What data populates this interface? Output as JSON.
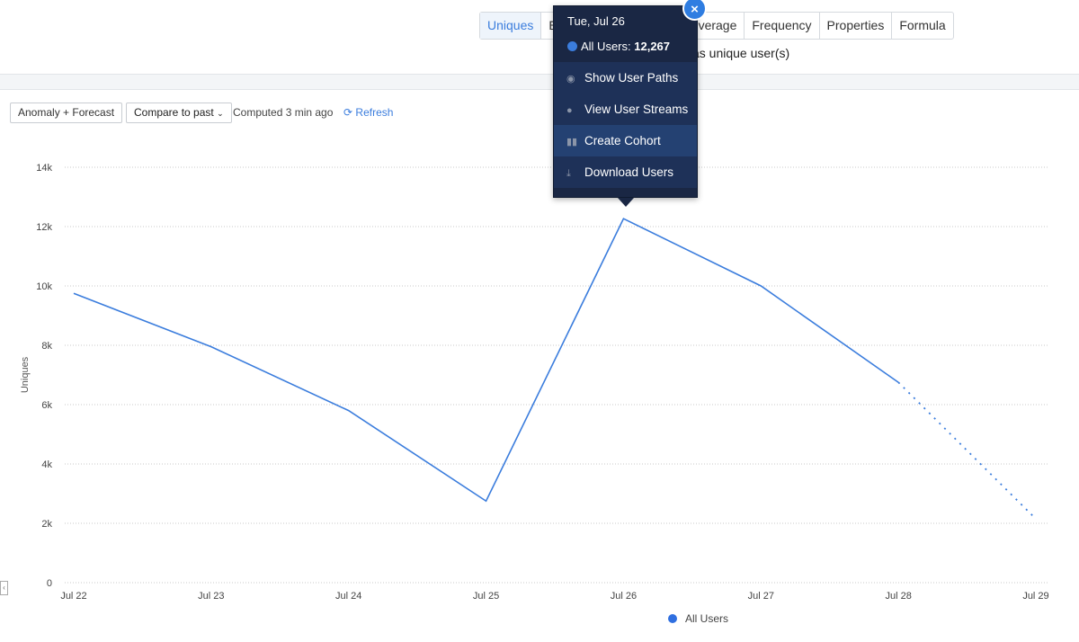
{
  "tabs": [
    {
      "label": "Uniques",
      "active": true
    },
    {
      "label": "E"
    },
    {
      "label": ""
    },
    {
      "label": "verage"
    },
    {
      "label": "Frequency"
    },
    {
      "label": "Properties"
    },
    {
      "label": "Formula"
    }
  ],
  "subtitle": "as unique user(s)",
  "toolbar": {
    "anomaly_label": "Anomaly + Forecast",
    "compare_label": "Compare to past",
    "compare_chevron": "⌄",
    "computed": "Computed 3 min ago",
    "refresh_label": "Refresh",
    "refresh_icon": "refresh-icon"
  },
  "tooltip": {
    "date": "Tue, Jul 26",
    "series": "All Users:",
    "value": "12,267",
    "close": "×",
    "actions": [
      {
        "label": "Show User Paths",
        "icon": "eye-icon"
      },
      {
        "label": "View User Streams",
        "icon": "user-icon"
      },
      {
        "label": "Create Cohort",
        "icon": "cohort-icon"
      },
      {
        "label": "Download Users",
        "icon": "download-icon"
      }
    ]
  },
  "chart_data": {
    "type": "line",
    "ylabel": "Uniques",
    "xlabel": "",
    "categories": [
      "Jul 22",
      "Jul 23",
      "Jul 24",
      "Jul 25",
      "Jul 26",
      "Jul 27",
      "Jul 28",
      "Jul 29"
    ],
    "series": [
      {
        "name": "All Users",
        "values": [
          9750,
          7950,
          5800,
          2750,
          12267,
          10000,
          6750,
          2150
        ],
        "color": "#3b7ddd",
        "forecast_from_index": 6
      }
    ],
    "ylim": [
      0,
      14000
    ],
    "yticks": [
      0,
      2000,
      4000,
      6000,
      8000,
      10000,
      12000,
      14000
    ],
    "ytick_labels": [
      "0",
      "2k",
      "4k",
      "6k",
      "8k",
      "10k",
      "12k",
      "14k"
    ],
    "grid": true,
    "legend": "bottom"
  }
}
